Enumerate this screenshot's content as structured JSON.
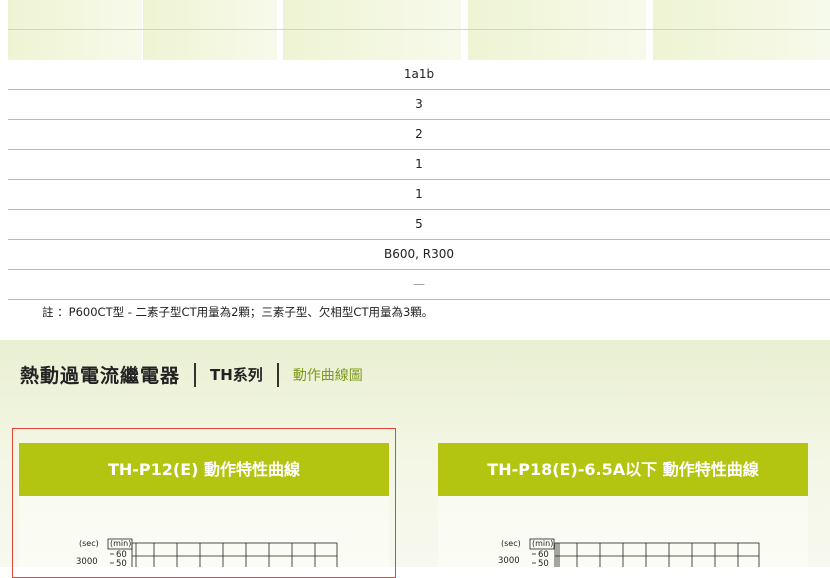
{
  "table": {
    "rows": [
      "1a1b",
      "3",
      "2",
      "1",
      "1",
      "5",
      "B600, R300",
      "—"
    ]
  },
  "note": "註 ：P600CT型 - 二素子型CT用量為2顆；三素子型、欠相型CT用量為3顆。",
  "section": {
    "title": "熱動過電流繼電器",
    "series": "TH系列",
    "crumb": "動作曲線圖"
  },
  "cards": [
    {
      "title": "TH-P12(E) 動作特性曲線",
      "axis_sec": "(sec)",
      "axis_min": "(min)",
      "tick_sec": "3000",
      "tick_min_1": "60",
      "tick_min_2": "50"
    },
    {
      "title": "TH-P18(E)-6.5A以下 動作特性曲線",
      "axis_sec": "(sec)",
      "axis_min": "(min)",
      "tick_sec": "3000",
      "tick_min_1": "60",
      "tick_min_2": "50"
    }
  ],
  "colors": {
    "accent": "#b3c510",
    "row_line": "#b7cc6b",
    "crumb": "#7d9a1a",
    "frame": "#e0453a"
  }
}
